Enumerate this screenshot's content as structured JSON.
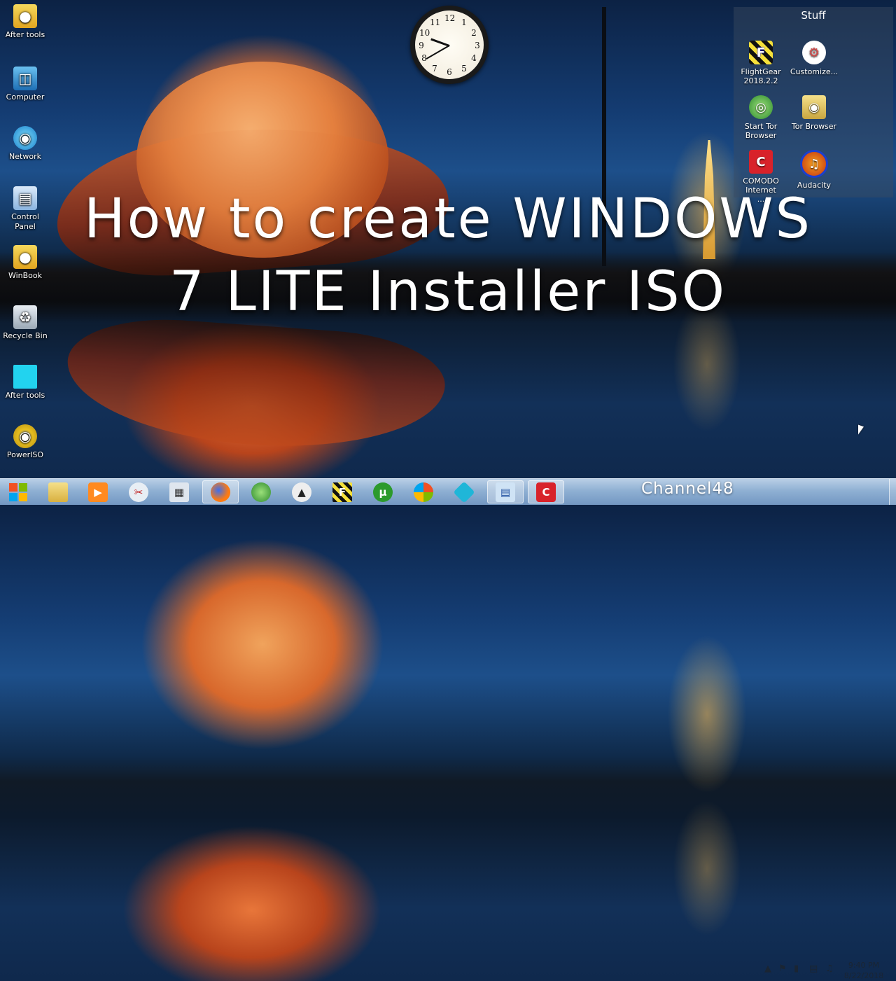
{
  "desktop_icons": [
    {
      "label": "After tools",
      "icon": "folder-user-icon"
    },
    {
      "label": "Computer",
      "icon": "computer-icon"
    },
    {
      "label": "Network",
      "icon": "network-icon"
    },
    {
      "label": "Control Panel",
      "icon": "control-panel-icon"
    },
    {
      "label": "WinBook",
      "icon": "folder-user-icon"
    },
    {
      "label": "Recycle Bin",
      "icon": "recycle-bin-icon"
    },
    {
      "label": "After tools",
      "icon": "cyan-page-icon"
    },
    {
      "label": "PowerISO",
      "icon": "poweriso-icon"
    }
  ],
  "clock_gadget": {
    "numbers": [
      "12",
      "1",
      "2",
      "3",
      "4",
      "5",
      "6",
      "7",
      "8",
      "9",
      "10",
      "11"
    ],
    "time": "9:40"
  },
  "gadget": {
    "title": "Stuff",
    "items": [
      {
        "label": "FlightGear 2018.2.2",
        "icon": "flightgear-icon"
      },
      {
        "label": "Customize...",
        "icon": "customize-icon"
      },
      {
        "label": "Start Tor Browser",
        "icon": "tor-globe-icon"
      },
      {
        "label": "Tor Browser",
        "icon": "tor-folder-icon"
      },
      {
        "label": "COMODO Internet ...",
        "icon": "comodo-icon"
      },
      {
        "label": "Audacity",
        "icon": "audacity-icon"
      }
    ]
  },
  "headline": {
    "line1": "How to create  WINDOWS",
    "line2": "7 LITE Installer ISO"
  },
  "taskbar": {
    "start_icon": "windows-start-icon",
    "pinned": [
      "explorer-icon",
      "media-player-icon",
      "snipping-tool-icon",
      "calculator-icon",
      "firefox-icon",
      "tor-globe-icon",
      "kodi-fox-icon",
      "flightgear-icon",
      "utorrent-icon",
      "windows-live-icon",
      "kodi-icon",
      "remote-desktop-icon",
      "ccleaner-icon"
    ],
    "channel": "Channel48",
    "tray_icons": [
      "show-hidden-icons",
      "flag-icon",
      "device-icon",
      "network-tray-icon",
      "volume-icon"
    ],
    "time": "9:40 PM",
    "date": "8/22/2018"
  },
  "colors": {
    "taskbar": "#8fb0d3",
    "gadget_bg": "#3c4b5f",
    "headline": "#ffffff"
  }
}
